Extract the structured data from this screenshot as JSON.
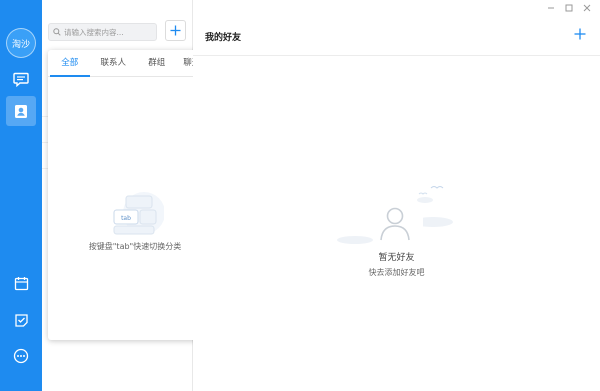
{
  "rail": {
    "avatar_text": "淘沙",
    "items": [
      {
        "icon": "chat-icon"
      },
      {
        "icon": "contacts-icon",
        "active": true
      },
      {
        "icon": "calendar-icon"
      },
      {
        "icon": "task-icon"
      },
      {
        "icon": "more-icon"
      }
    ],
    "color": "#1e8bf0"
  },
  "list": {
    "search_placeholder": "请输入搜索内容...",
    "popup": {
      "tabs": [
        "全部",
        "联系人",
        "群组",
        "聊天记录"
      ],
      "active_tab": 0,
      "illustration_key": "tab",
      "hint": "按键盘\"tab\"快速切换分类"
    }
  },
  "main": {
    "title": "我的好友",
    "empty_title": "暂无好友",
    "empty_subtitle": "快去添加好友吧"
  },
  "window_controls": [
    "minimize-icon",
    "maximize-icon",
    "close-icon"
  ]
}
